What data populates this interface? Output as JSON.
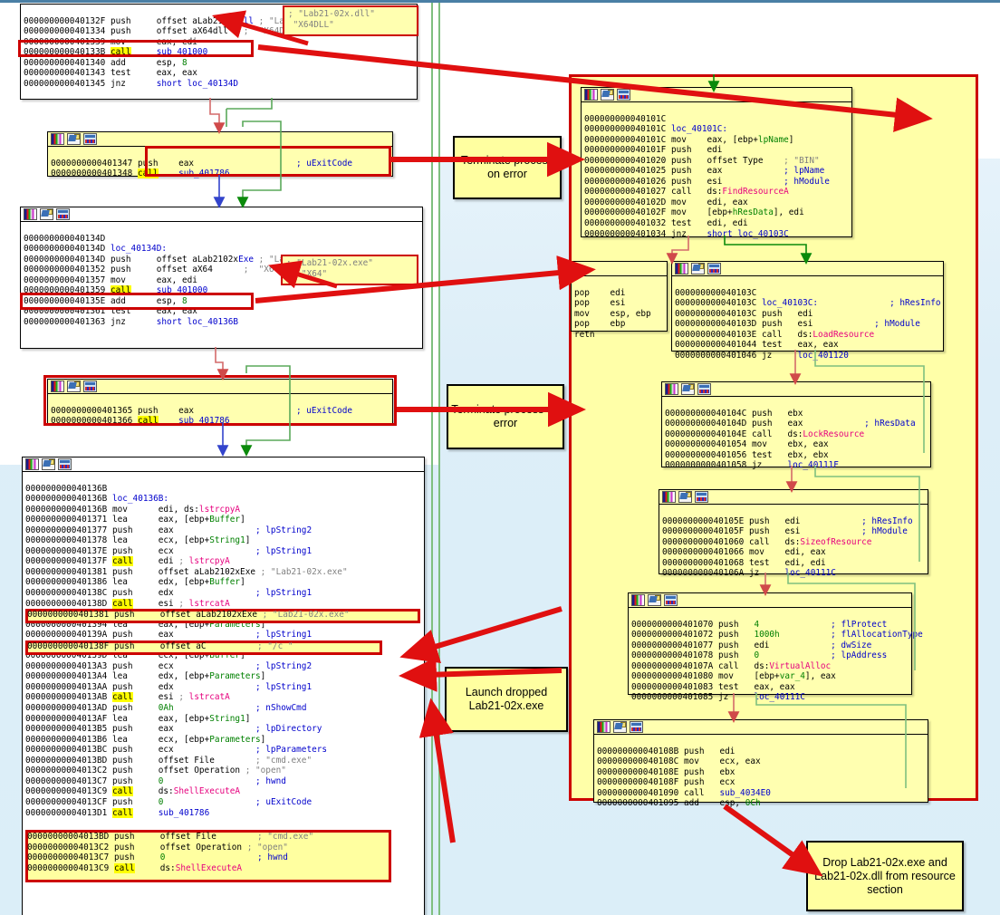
{
  "meta": {
    "app": "IDA Pro graph view — Lab21-02 analysis",
    "accent_red": "#cc0000",
    "node_yellow": "#ffffb0",
    "background": "#ddeef8"
  },
  "notes": [
    {
      "id": "note-terminate-1",
      "text": "Terminate process on error"
    },
    {
      "id": "note-terminate-2",
      "text": "Terminate process on error"
    },
    {
      "id": "note-launch",
      "text": "Launch dropped Lab21-02x.exe"
    },
    {
      "id": "note-drop",
      "text": "Drop Lab21-02x.exe and Lab21-02x.dll from resource section"
    }
  ],
  "string_callouts": [
    {
      "id": "strbox-dll",
      "lines": [
        "; \"Lab21-02x.dll\"",
        "\"X64DLL\""
      ]
    },
    {
      "id": "strbox-exe",
      "lines": [
        "; \"Lab21-02x.exe\"",
        "; \"X64\""
      ]
    }
  ],
  "blocks": {
    "block_40132F": {
      "id": "node-40132F",
      "lines": [
        {
          "ea": "000000000040132F",
          "mn": "push",
          "ops": "offset aLab2102xDll ; \"Lab21-02x.dll\""
        },
        {
          "ea": "0000000000401334",
          "mn": "push",
          "ops": "offset aX64dll     ; \"X64DLL\""
        },
        {
          "ea": "0000000000401339",
          "mn": "mov",
          "ops": "eax, edi"
        },
        {
          "ea": "000000000040133B",
          "mn": "call",
          "ops": "sub_401000",
          "highlight": true
        },
        {
          "ea": "0000000000401340",
          "mn": "add",
          "ops": "esp, 8"
        },
        {
          "ea": "0000000000401343",
          "mn": "test",
          "ops": "eax, eax"
        },
        {
          "ea": "0000000000401345",
          "mn": "jnz",
          "ops": "short loc_40134D"
        }
      ]
    },
    "block_401347": {
      "id": "node-401347",
      "lines": [
        {
          "ea": "0000000000401347",
          "mn": "push",
          "ops": "eax                     ; uExitCode"
        },
        {
          "ea": "0000000000401348",
          "mn": "call",
          "ops": "sub_401786",
          "highlight": true
        }
      ]
    },
    "block_40134D": {
      "id": "node-40134D",
      "lines": [
        {
          "ea": "000000000040134D",
          "mn": "",
          "ops": ""
        },
        {
          "ea": "000000000040134D",
          "mn": "",
          "ops": "loc_40134D:"
        },
        {
          "ea": "000000000040134D",
          "mn": "push",
          "ops": "offset aLab2102xExe ; \"Lab21-02x.exe\""
        },
        {
          "ea": "0000000000401352",
          "mn": "push",
          "ops": "offset aX64        ; \"X64\""
        },
        {
          "ea": "0000000000401357",
          "mn": "mov",
          "ops": "eax, edi"
        },
        {
          "ea": "0000000000401359",
          "mn": "call",
          "ops": "sub_401000",
          "highlight": true
        },
        {
          "ea": "000000000040135E",
          "mn": "add",
          "ops": "esp, 8"
        },
        {
          "ea": "0000000000401361",
          "mn": "test",
          "ops": "eax, eax"
        },
        {
          "ea": "0000000000401363",
          "mn": "jnz",
          "ops": "short loc_40136B"
        }
      ]
    },
    "block_401365": {
      "id": "node-401365",
      "lines": [
        {
          "ea": "0000000000401365",
          "mn": "push",
          "ops": "eax                     ; uExitCode"
        },
        {
          "ea": "0000000000401366",
          "mn": "call",
          "ops": "sub_401786",
          "highlight": true
        }
      ]
    },
    "block_40136B": {
      "id": "node-40136B",
      "lines": [
        {
          "ea": "000000000040136B",
          "mn": "",
          "ops": ""
        },
        {
          "ea": "000000000040136B",
          "mn": "",
          "ops": "loc_40136B:"
        },
        {
          "ea": "000000000040136B",
          "mn": "mov",
          "ops": "edi, ds:lstrcpyA"
        },
        {
          "ea": "0000000000401371",
          "mn": "lea",
          "ops": "eax, [ebp+Buffer]"
        },
        {
          "ea": "0000000000401377",
          "mn": "push",
          "ops": "eax                ; lpString2"
        },
        {
          "ea": "0000000000401378",
          "mn": "lea",
          "ops": "ecx, [ebp+String1]"
        },
        {
          "ea": "000000000040137E",
          "mn": "push",
          "ops": "ecx                ; lpString1"
        },
        {
          "ea": "000000000040137F",
          "mn": "call",
          "ops": "edi ; lstrcpyA",
          "highlight": true
        },
        {
          "ea": "0000000000401381",
          "mn": "push",
          "ops": "offset aLab2102xExe ; \"Lab21-02x.exe\""
        },
        {
          "ea": "0000000000401386",
          "mn": "lea",
          "ops": "edx, [ebp+Buffer]"
        },
        {
          "ea": "000000000040138C",
          "mn": "push",
          "ops": "edx                ; lpString1"
        },
        {
          "ea": "000000000040138D",
          "mn": "call",
          "ops": "esi ; lstrcatA",
          "highlight": true
        },
        {
          "ea": "000000000040138F",
          "mn": "push",
          "ops": "offset aC          ; \"/c \""
        },
        {
          "ea": "0000000000401394",
          "mn": "lea",
          "ops": "eax, [ebp+Parameters]"
        },
        {
          "ea": "000000000040139A",
          "mn": "push",
          "ops": "eax                ; lpString1"
        },
        {
          "ea": "000000000040139B",
          "mn": "call",
          "ops": "edi ; lstrcpyA",
          "highlight": true
        },
        {
          "ea": "000000000040139D",
          "mn": "lea",
          "ops": "ecx, [ebp+Buffer]"
        },
        {
          "ea": "00000000004013A3",
          "mn": "push",
          "ops": "ecx                ; lpString2"
        },
        {
          "ea": "00000000004013A4",
          "mn": "lea",
          "ops": "edx, [ebp+Parameters]"
        },
        {
          "ea": "00000000004013AA",
          "mn": "push",
          "ops": "edx                ; lpString1"
        },
        {
          "ea": "00000000004013AB",
          "mn": "call",
          "ops": "esi ; lstrcatA",
          "highlight": true
        },
        {
          "ea": "00000000004013AD",
          "mn": "push",
          "ops": "0Ah                ; nShowCmd"
        },
        {
          "ea": "00000000004013AF",
          "mn": "lea",
          "ops": "eax, [ebp+String1]"
        },
        {
          "ea": "00000000004013B5",
          "mn": "push",
          "ops": "eax                ; lpDirectory"
        },
        {
          "ea": "00000000004013B6",
          "mn": "lea",
          "ops": "ecx, [ebp+Parameters]"
        },
        {
          "ea": "00000000004013BC",
          "mn": "push",
          "ops": "ecx                ; lpParameters"
        },
        {
          "ea": "00000000004013BD",
          "mn": "push",
          "ops": "offset File        ; \"cmd.exe\""
        },
        {
          "ea": "00000000004013C2",
          "mn": "push",
          "ops": "offset Operation ; \"open\""
        },
        {
          "ea": "00000000004013C7",
          "mn": "push",
          "ops": "0                  ; hwnd"
        },
        {
          "ea": "00000000004013C9",
          "mn": "call",
          "ops": "ds:ShellExecuteA",
          "highlight": true
        },
        {
          "ea": "00000000004013CF",
          "mn": "push",
          "ops": "0                  ; uExitCode"
        },
        {
          "ea": "00000000004013D1",
          "mn": "call",
          "ops": "sub_401786",
          "highlight": true
        }
      ]
    },
    "block_40101C": {
      "id": "node-40101C",
      "lines": [
        {
          "ea": "000000000040101C",
          "mn": "",
          "ops": ""
        },
        {
          "ea": "000000000040101C",
          "mn": "",
          "ops": "loc_40101C:"
        },
        {
          "ea": "000000000040101C",
          "mn": "mov",
          "ops": "eax, [ebp+lpName]"
        },
        {
          "ea": "000000000040101F",
          "mn": "push",
          "ops": "edi"
        },
        {
          "ea": "0000000000401020",
          "mn": "push",
          "ops": "offset Type     ; \"BIN\""
        },
        {
          "ea": "0000000000401025",
          "mn": "push",
          "ops": "eax             ; lpName"
        },
        {
          "ea": "0000000000401026",
          "mn": "push",
          "ops": "esi             ; hModule"
        },
        {
          "ea": "0000000000401027",
          "mn": "call",
          "ops": "ds:FindResourceA"
        },
        {
          "ea": "000000000040102D",
          "mn": "mov",
          "ops": "edi, eax"
        },
        {
          "ea": "000000000040102F",
          "mn": "mov",
          "ops": "[ebp+hResData], edi"
        },
        {
          "ea": "0000000000401032",
          "mn": "test",
          "ops": "edi, edi"
        },
        {
          "ea": "0000000000401034",
          "mn": "jnz",
          "ops": "short loc_40103C"
        }
      ]
    },
    "block_epilogue": {
      "id": "node-epilogue",
      "lines": [
        {
          "ea": "",
          "mn": "pop",
          "ops": "edi"
        },
        {
          "ea": "",
          "mn": "pop",
          "ops": "esi"
        },
        {
          "ea": "",
          "mn": "mov",
          "ops": "esp, ebp"
        },
        {
          "ea": "",
          "mn": "pop",
          "ops": "ebp"
        },
        {
          "ea": "",
          "mn": "retn",
          "ops": ""
        }
      ]
    },
    "block_40103C": {
      "id": "node-40103C",
      "lines": [
        {
          "ea": "000000000040103C",
          "mn": "",
          "ops": ""
        },
        {
          "ea": "000000000040103C",
          "mn": "",
          "ops": "loc_40103C:                    ; hResInfo"
        },
        {
          "ea": "000000000040103C",
          "mn": "push",
          "ops": "edi"
        },
        {
          "ea": "000000000040103D",
          "mn": "push",
          "ops": "esi             ; hModule"
        },
        {
          "ea": "000000000040103E",
          "mn": "call",
          "ops": "ds:LoadResource"
        },
        {
          "ea": "0000000000401044",
          "mn": "test",
          "ops": "eax, eax"
        },
        {
          "ea": "0000000000401046",
          "mn": "jz",
          "ops": "loc_401120"
        }
      ]
    },
    "block_40104C": {
      "id": "node-40104C",
      "lines": [
        {
          "ea": "000000000040104C",
          "mn": "push",
          "ops": "ebx"
        },
        {
          "ea": "000000000040104D",
          "mn": "push",
          "ops": "eax             ; hResData"
        },
        {
          "ea": "000000000040104E",
          "mn": "call",
          "ops": "ds:LockResource"
        },
        {
          "ea": "0000000000401054",
          "mn": "mov",
          "ops": "ebx, eax"
        },
        {
          "ea": "0000000000401056",
          "mn": "test",
          "ops": "ebx, ebx"
        },
        {
          "ea": "0000000000401058",
          "mn": "jz",
          "ops": "loc_40111F"
        }
      ]
    },
    "block_40105E": {
      "id": "node-40105E",
      "lines": [
        {
          "ea": "000000000040105E",
          "mn": "push",
          "ops": "edi             ; hResInfo"
        },
        {
          "ea": "000000000040105F",
          "mn": "push",
          "ops": "esi             ; hModule"
        },
        {
          "ea": "0000000000401060",
          "mn": "call",
          "ops": "ds:SizeofResource"
        },
        {
          "ea": "0000000000401066",
          "mn": "mov",
          "ops": "edi, eax"
        },
        {
          "ea": "0000000000401068",
          "mn": "test",
          "ops": "edi, edi"
        },
        {
          "ea": "000000000040106A",
          "mn": "jz",
          "ops": "loc_40111C"
        }
      ]
    },
    "block_401070": {
      "id": "node-401070",
      "lines": [
        {
          "ea": "0000000000401070",
          "mn": "push",
          "ops": "4               ; flProtect"
        },
        {
          "ea": "0000000000401072",
          "mn": "push",
          "ops": "1000h           ; flAllocationType"
        },
        {
          "ea": "0000000000401077",
          "mn": "push",
          "ops": "edi             ; dwSize"
        },
        {
          "ea": "0000000000401078",
          "mn": "push",
          "ops": "0               ; lpAddress"
        },
        {
          "ea": "000000000040107A",
          "mn": "call",
          "ops": "ds:VirtualAlloc"
        },
        {
          "ea": "0000000000401080",
          "mn": "mov",
          "ops": "[ebp+var_4], eax"
        },
        {
          "ea": "0000000000401083",
          "mn": "test",
          "ops": "eax, eax"
        },
        {
          "ea": "0000000000401085",
          "mn": "jz",
          "ops": "loc_40111C"
        }
      ]
    },
    "block_40108B": {
      "id": "node-40108B",
      "lines": [
        {
          "ea": "000000000040108B",
          "mn": "push",
          "ops": "edi"
        },
        {
          "ea": "000000000040108C",
          "mn": "mov",
          "ops": "ecx, eax"
        },
        {
          "ea": "000000000040108E",
          "mn": "push",
          "ops": "ebx"
        },
        {
          "ea": "000000000040108F",
          "mn": "push",
          "ops": "ecx"
        },
        {
          "ea": "0000000000401090",
          "mn": "call",
          "ops": "sub_4034E0"
        },
        {
          "ea": "0000000000401095",
          "mn": "add",
          "ops": "esp, 0Ch"
        }
      ]
    }
  }
}
